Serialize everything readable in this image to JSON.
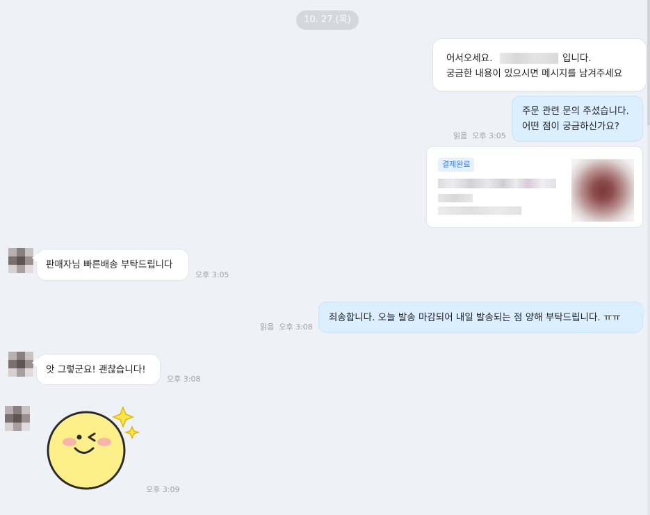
{
  "date_divider": "10. 27.(목)",
  "messages": {
    "greeting": {
      "line1_prefix": "어서오세요.",
      "line1_suffix": "입니다.",
      "line2": "궁금한 내용이 있으시면 메시지를 남겨주세요"
    },
    "order_inquiry": {
      "line1": "주문 관련 문의 주셨습니다.",
      "line2": "어떤 점이 궁금하신가요?",
      "read": "읽음",
      "time": "오후 3:05"
    },
    "order_card": {
      "status_badge": "결제완료"
    },
    "customer_1": {
      "text": "판매자님 빠른배송 부탁드립니다",
      "time": "오후 3:05"
    },
    "seller_reply": {
      "text": "죄송합니다. 오늘 발송 마감되어 내일 발송되는 점 양해 부탁드립니다. ㅠㅠ",
      "read": "읽음",
      "time": "오후 3:08"
    },
    "customer_2": {
      "text": "앗 그렇군요! 괜찮습니다!",
      "time": "오후 3:08"
    },
    "customer_sticker": {
      "icon": "winking-smiley-sticker-icon",
      "time": "오후 3:09"
    }
  },
  "colors": {
    "background": "#eef1f6",
    "seller_bubble": "#dcefff",
    "customer_bubble": "#ffffff",
    "badge_text": "#3b7ddd",
    "meta_text": "#9aa0a8"
  }
}
